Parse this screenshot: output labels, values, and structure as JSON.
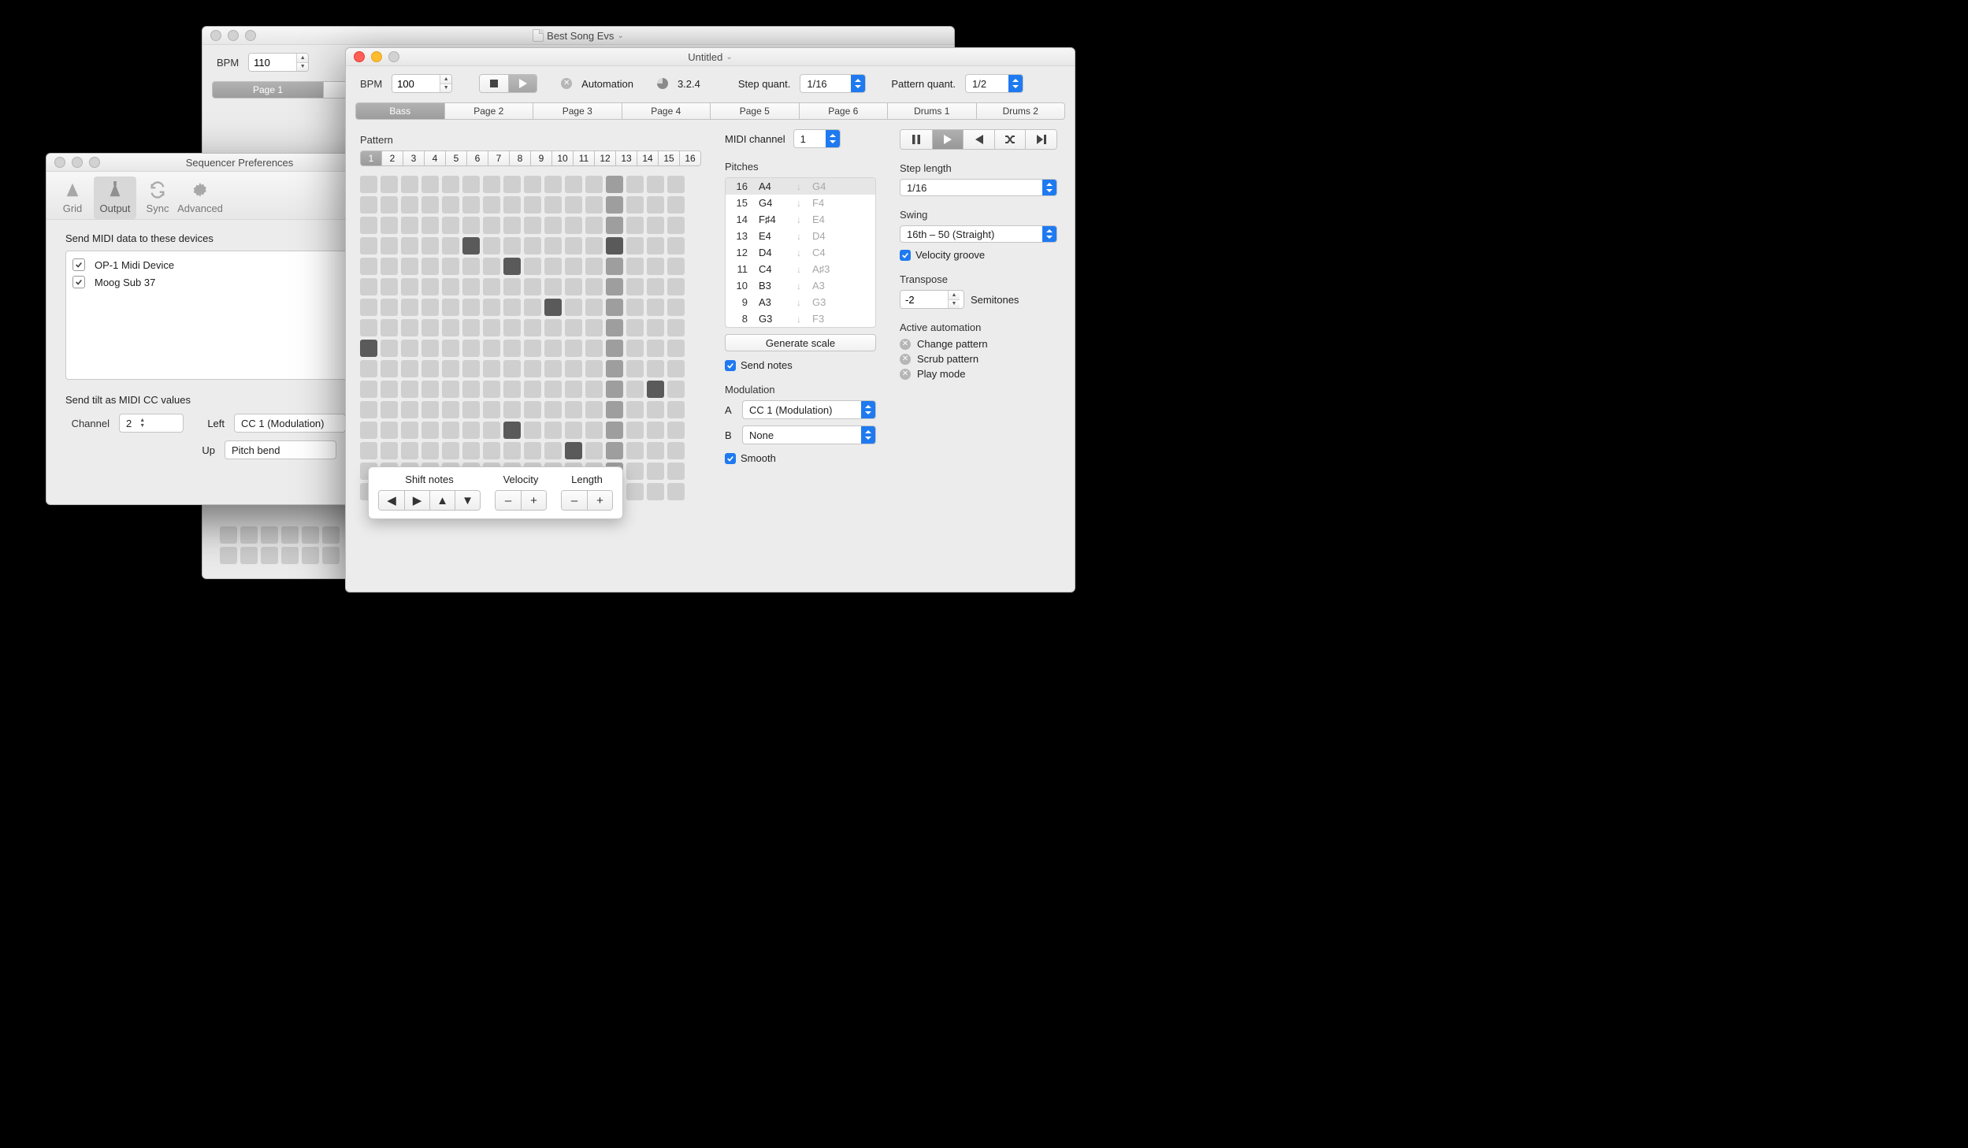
{
  "back_window": {
    "title": "Best Song Evs",
    "bpm_label": "BPM",
    "bpm_value": "110",
    "tabs": [
      "Page 1"
    ]
  },
  "prefs_window": {
    "title": "Sequencer Preferences",
    "tabs": [
      {
        "id": "grid",
        "label": "Grid"
      },
      {
        "id": "output",
        "label": "Output"
      },
      {
        "id": "sync",
        "label": "Sync"
      },
      {
        "id": "advanced",
        "label": "Advanced"
      }
    ],
    "active_tab": "output",
    "send_devices_heading": "Send MIDI data to these devices",
    "devices": [
      {
        "name": "OP-1 Midi Device",
        "checked": true
      },
      {
        "name": "Moog Sub 37",
        "checked": true
      }
    ],
    "tilt_heading": "Send tilt as MIDI CC values",
    "channel_label": "Channel",
    "channel_value": "2",
    "left_label": "Left",
    "left_value": "CC 1 (Modulation)",
    "up_label": "Up",
    "up_value": "Pitch bend"
  },
  "main_window": {
    "title": "Untitled",
    "toolbar": {
      "bpm_label": "BPM",
      "bpm_value": "100",
      "automation_label": "Automation",
      "beat_display": "3.2.4",
      "step_quant_label": "Step quant.",
      "step_quant_value": "1/16",
      "pattern_quant_label": "Pattern quant.",
      "pattern_quant_value": "1/2"
    },
    "pages": [
      "Bass",
      "Page 2",
      "Page 3",
      "Page 4",
      "Page 5",
      "Page 6",
      "Drums 1",
      "Drums 2"
    ],
    "active_page": "Bass",
    "pattern": {
      "heading": "Pattern",
      "numbers": [
        "1",
        "2",
        "3",
        "4",
        "5",
        "6",
        "7",
        "8",
        "9",
        "10",
        "11",
        "12",
        "13",
        "14",
        "15",
        "16"
      ],
      "active": "1",
      "active_col": 13,
      "dark_cells": [
        [
          9,
          1
        ],
        [
          4,
          6
        ],
        [
          5,
          8
        ],
        [
          13,
          8
        ],
        [
          7,
          10
        ],
        [
          14,
          11
        ],
        [
          4,
          13
        ],
        [
          11,
          15
        ]
      ],
      "shift": {
        "shift_label": "Shift notes",
        "velocity_label": "Velocity",
        "length_label": "Length",
        "left": "◀",
        "right": "▶",
        "up": "▲",
        "down": "▼",
        "minus": "–",
        "plus": "+"
      }
    },
    "midi": {
      "channel_label": "MIDI channel",
      "channel_value": "1",
      "pitches_heading": "Pitches",
      "pitches": [
        {
          "n": "16",
          "p": "A4",
          "g": "G4",
          "sel": true
        },
        {
          "n": "15",
          "p": "G4",
          "g": "F4"
        },
        {
          "n": "14",
          "p": "F♯4",
          "g": "E4"
        },
        {
          "n": "13",
          "p": "E4",
          "g": "D4"
        },
        {
          "n": "12",
          "p": "D4",
          "g": "C4"
        },
        {
          "n": "11",
          "p": "C4",
          "g": "A♯3"
        },
        {
          "n": "10",
          "p": "B3",
          "g": "A3"
        },
        {
          "n": "9",
          "p": "A3",
          "g": "G3"
        },
        {
          "n": "8",
          "p": "G3",
          "g": "F3"
        }
      ],
      "generate_label": "Generate scale",
      "send_notes_label": "Send notes",
      "modulation_heading": "Modulation",
      "mod_a_label": "A",
      "mod_a_value": "CC 1 (Modulation)",
      "mod_b_label": "B",
      "mod_b_value": "None",
      "smooth_label": "Smooth"
    },
    "right": {
      "step_len_heading": "Step length",
      "step_len_value": "1/16",
      "swing_heading": "Swing",
      "swing_value": "16th – 50 (Straight)",
      "vel_groove_label": "Velocity groove",
      "transpose_heading": "Transpose",
      "transpose_value": "-2",
      "transpose_unit": "Semitones",
      "automation_heading": "Active automation",
      "automation": [
        "Change pattern",
        "Scrub pattern",
        "Play mode"
      ]
    }
  }
}
